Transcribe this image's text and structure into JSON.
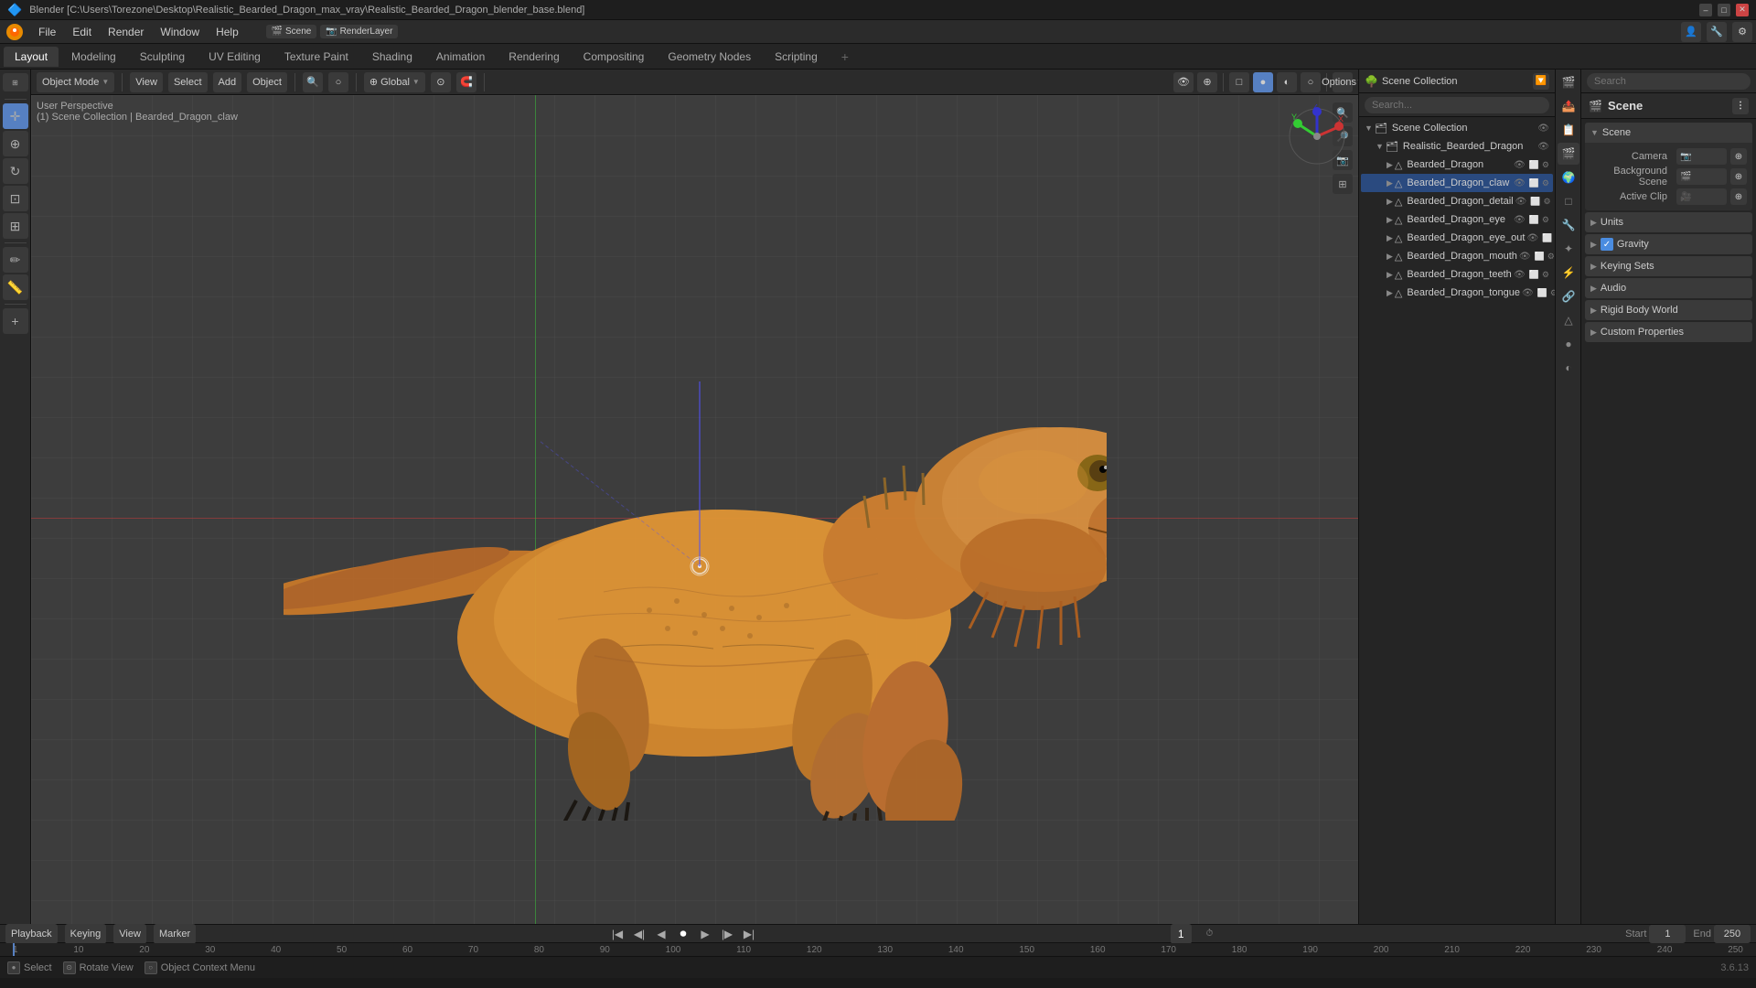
{
  "window": {
    "title": "Blender [C:\\Users\\Torezone\\Desktop\\Realistic_Bearded_Dragon_max_vray\\Realistic_Bearded_Dragon_blender_base.blend]",
    "version": "3.6.13"
  },
  "menu": {
    "items": [
      "Blender",
      "File",
      "Edit",
      "Render",
      "Window",
      "Help"
    ]
  },
  "workspaces": {
    "tabs": [
      "Layout",
      "Modeling",
      "Sculpting",
      "UV Editing",
      "Texture Paint",
      "Shading",
      "Animation",
      "Rendering",
      "Compositing",
      "Geometry Nodes",
      "Scripting",
      "+"
    ],
    "active": "Layout"
  },
  "viewport": {
    "mode": "Object Mode",
    "shading": "User Perspective",
    "scene_path": "(1) Scene Collection | Bearded_Dragon_claw",
    "transform": "Global",
    "options_label": "Options"
  },
  "outliner": {
    "title": "Scene Collection",
    "items": [
      {
        "name": "Realistic_Bearded_Dragon",
        "indent": 0,
        "expanded": true,
        "type": "collection",
        "visible": true
      },
      {
        "name": "Bearded_Dragon",
        "indent": 1,
        "expanded": false,
        "type": "object",
        "visible": true
      },
      {
        "name": "Bearded_Dragon_claw",
        "indent": 1,
        "expanded": false,
        "type": "object",
        "visible": true,
        "selected": true
      },
      {
        "name": "Bearded_Dragon_detail",
        "indent": 1,
        "expanded": false,
        "type": "object",
        "visible": true
      },
      {
        "name": "Bearded_Dragon_eye",
        "indent": 1,
        "expanded": false,
        "type": "object",
        "visible": true
      },
      {
        "name": "Bearded_Dragon_eye_out",
        "indent": 1,
        "expanded": false,
        "type": "object",
        "visible": true
      },
      {
        "name": "Bearded_Dragon_mouth",
        "indent": 1,
        "expanded": false,
        "type": "object",
        "visible": true
      },
      {
        "name": "Bearded_Dragon_teeth",
        "indent": 1,
        "expanded": false,
        "type": "object",
        "visible": true
      },
      {
        "name": "Bearded_Dragon_tongue",
        "indent": 1,
        "expanded": false,
        "type": "object",
        "visible": true
      }
    ]
  },
  "properties": {
    "active_tab": "scene",
    "scene_label": "Scene",
    "tabs": [
      "render",
      "output",
      "view_layer",
      "scene",
      "world",
      "object",
      "modifier",
      "particles",
      "physics",
      "constraints",
      "object_data",
      "material",
      "shader"
    ],
    "scene_name": "Scene",
    "sections": {
      "scene": {
        "label": "Scene",
        "camera_label": "Camera",
        "background_scene_label": "Background Scene",
        "active_clip_label": "Active Clip"
      },
      "units": {
        "label": "Units"
      },
      "gravity": {
        "label": "Gravity",
        "checked": true
      },
      "keying_sets": {
        "label": "Keying Sets"
      },
      "audio": {
        "label": "Audio"
      },
      "rigid_body_world": {
        "label": "Rigid Body World"
      },
      "custom_properties": {
        "label": "Custom Properties"
      }
    }
  },
  "timeline": {
    "current_frame": "1",
    "start_frame": "1",
    "end_frame": "250",
    "playback_label": "Playback",
    "keying_label": "Keying",
    "view_label": "View",
    "marker_label": "Marker",
    "frame_markers": [
      "1",
      "10",
      "20",
      "30",
      "40",
      "50",
      "60",
      "70",
      "80",
      "90",
      "100",
      "110",
      "120",
      "130",
      "140",
      "150",
      "160",
      "170",
      "180",
      "190",
      "200",
      "210",
      "220",
      "230",
      "240",
      "250"
    ]
  },
  "status_bar": {
    "select_label": "Select",
    "rotate_view_label": "Rotate View",
    "object_context_label": "Object Context Menu",
    "version": "3.6.13"
  },
  "toolbar": {
    "tools": [
      "cursor",
      "move",
      "rotate",
      "scale",
      "transform",
      "annotate",
      "measure",
      "add"
    ],
    "right_tools": [
      "view",
      "zoom",
      "orbit"
    ]
  }
}
